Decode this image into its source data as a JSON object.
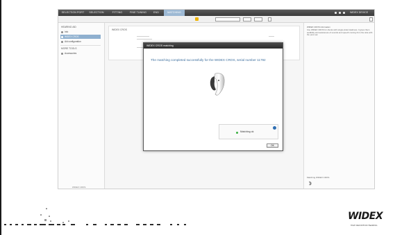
{
  "menubar": {
    "items": [
      {
        "label": "SELECTION PORT",
        "active": false
      },
      {
        "label": "SELECTION",
        "active": false
      },
      {
        "label": "FITTING",
        "active": false
      },
      {
        "label": "FINE TUNING",
        "active": false
      },
      {
        "label": "END",
        "active": false
      },
      {
        "label": "MATCHING",
        "active": true
      }
    ],
    "right_label": "WIDEX DEVICE"
  },
  "sidebar": {
    "heading": "HEARING AID",
    "items": [
      {
        "label": "Info",
        "selected": false
      },
      {
        "label": "WIDEX CROS",
        "selected": true
      },
      {
        "label": "Aid configuration",
        "selected": false
      }
    ],
    "heading2": "MORE TOOLS",
    "tools": [
      {
        "label": "Accessories"
      }
    ],
    "footer": "WIDEX CROS"
  },
  "center": {
    "panel_title": "WIDEX CROS"
  },
  "right_pane": {
    "heading": "WIDEX CROS information",
    "body": "Use WIDEX CROS for clients with single-sided deafness. It gives them audibility and awareness of sounds and speech coming from the side with the poor ear.",
    "footer": "Matching WIDEX CROS"
  },
  "modal": {
    "title": "WIDEX CROS matching",
    "message": "The matching completed successfully for the WIDEX CROS, serial number 11792",
    "status": "Matching ok",
    "ok_label": "OK"
  },
  "logo": {
    "text": "WIDEX",
    "tagline": "HIGH DEFINITION HEARING"
  },
  "colors": {
    "accent": "#3d6f9e",
    "menubar": "#3a3a3a",
    "active_tab": "#9db9d4",
    "status_ok": "#3cb043"
  }
}
